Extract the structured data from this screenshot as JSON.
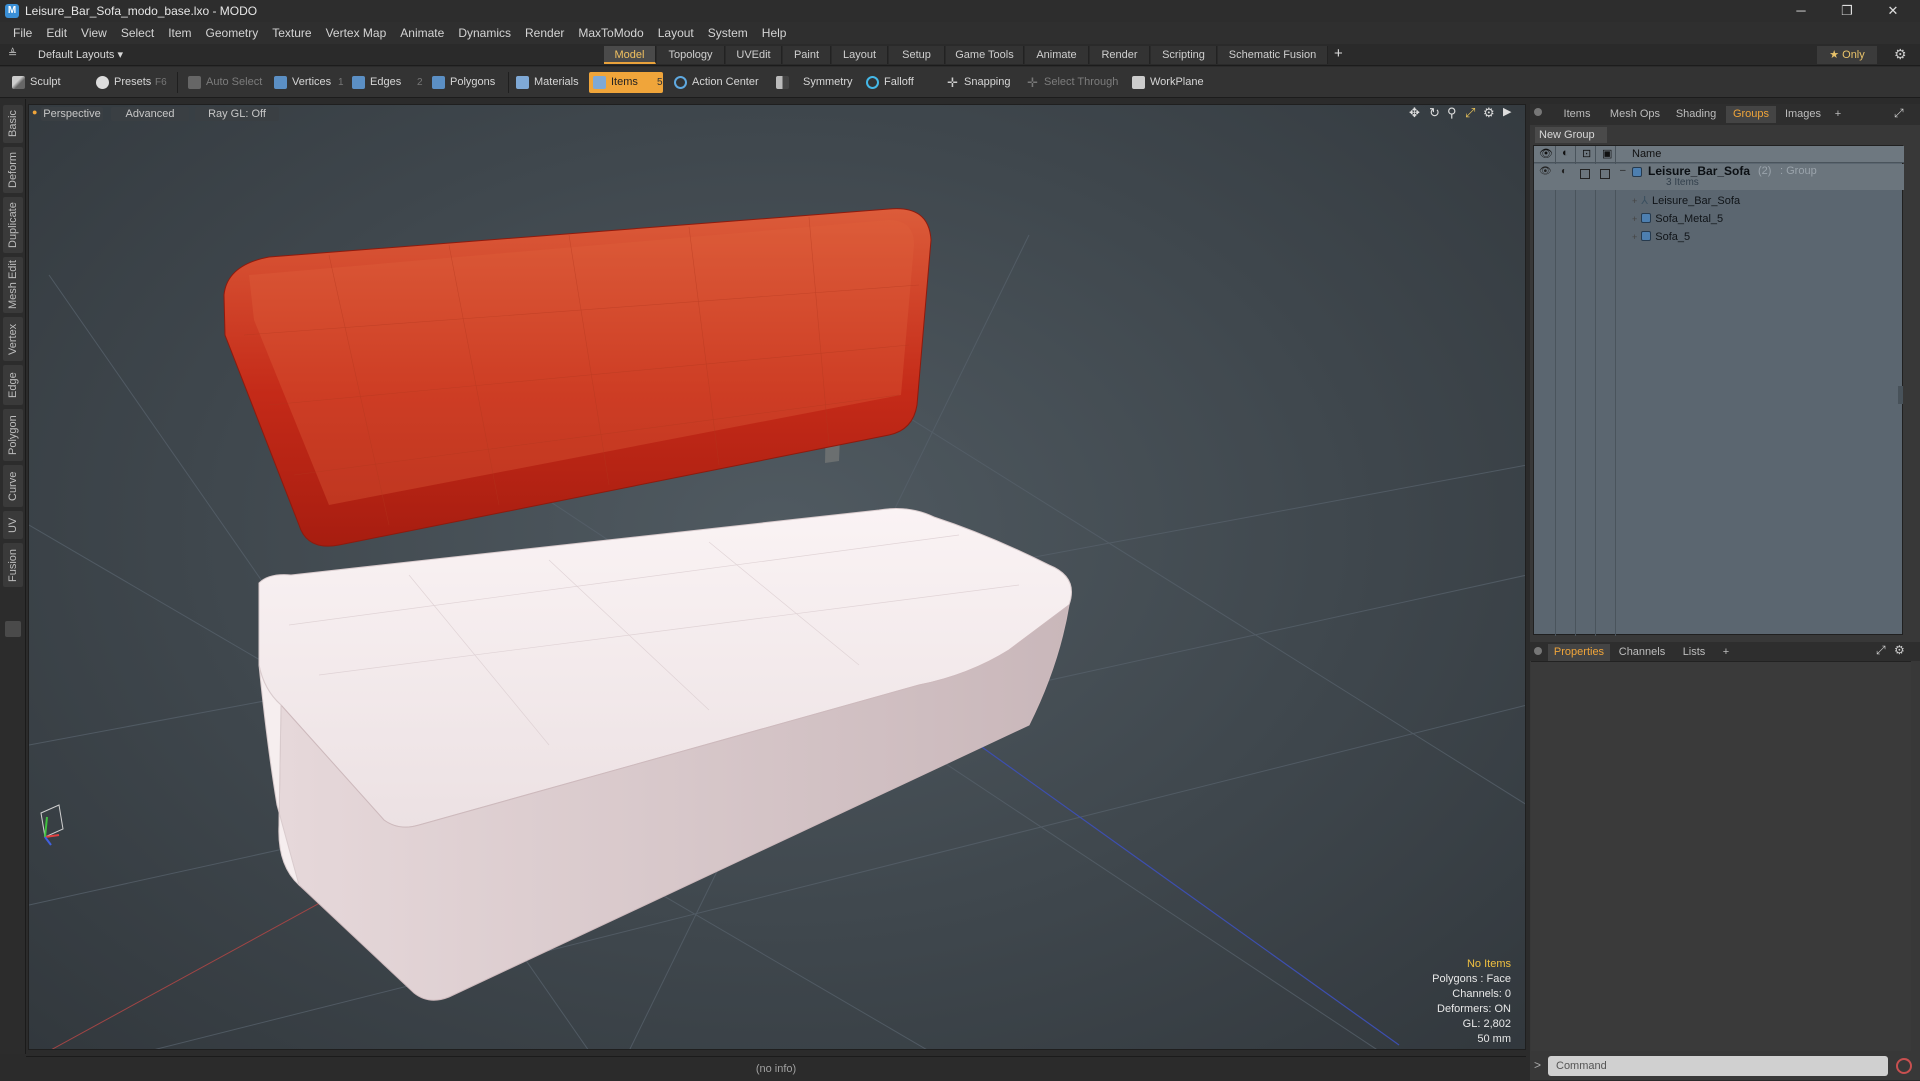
{
  "window": {
    "title": "Leisure_Bar_Sofa_modo_base.lxo - MODO",
    "app_icon": "modo-app-icon",
    "controls": [
      "minimize-icon",
      "restore-icon",
      "close-icon"
    ]
  },
  "menu": [
    "File",
    "Edit",
    "View",
    "Select",
    "Item",
    "Geometry",
    "Texture",
    "Vertex Map",
    "Animate",
    "Dynamics",
    "Render",
    "MaxToModo",
    "Layout",
    "System",
    "Help"
  ],
  "layout_bar": {
    "preset": "Default Layouts ▾",
    "tabs": [
      "Model",
      "Topology",
      "UVEdit",
      "Paint",
      "Layout",
      "Setup",
      "Game Tools",
      "Animate",
      "Render",
      "Scripting",
      "Schematic Fusion"
    ],
    "active_tab": "Model",
    "add_label": "+",
    "only_label": "★  Only"
  },
  "toolbar": {
    "sculpt": "Sculpt",
    "presets": "Presets",
    "presets_key": "F6",
    "auto_select": "Auto Select",
    "vertices": "Vertices",
    "vertices_key": "1",
    "edges": "Edges",
    "edges_key": "2",
    "polygons": "Polygons",
    "materials": "Materials",
    "items": "Items",
    "items_key": "5",
    "action_center": "Action Center",
    "symmetry": "Symmetry",
    "falloff": "Falloff",
    "snapping": "Snapping",
    "select_through": "Select Through",
    "workplane": "WorkPlane"
  },
  "left_tabs": [
    "Basic",
    "Deform",
    "Duplicate",
    "Mesh Edit",
    "Vertex",
    "Edge",
    "Polygon",
    "Curve",
    "UV",
    "Fusion"
  ],
  "viewport": {
    "view_mode": "Perspective",
    "shading": "Advanced",
    "raygl": "Ray GL: Off",
    "hud": {
      "selection": "No Items",
      "polygons": "Polygons : Face",
      "channels": "Channels: 0",
      "deformers": "Deformers: ON",
      "gl": "GL: 2,802",
      "lens": "50 mm"
    }
  },
  "status": "(no info)",
  "groups_panel": {
    "tabs": [
      "Items",
      "Mesh Ops",
      "Shading",
      "Groups",
      "Images",
      "+"
    ],
    "active_tab": "Groups",
    "new_group": "New Group",
    "name_header": "Name",
    "group_name": "Leisure_Bar_Sofa",
    "group_count": "(2)",
    "group_type": ": Group",
    "group_items": "3 Items",
    "children": [
      "Leisure_Bar_Sofa",
      "Sofa_Metal_5",
      "Sofa_5"
    ]
  },
  "properties_panel": {
    "tabs": [
      "Properties",
      "Channels",
      "Lists",
      "+"
    ],
    "active_tab": "Properties"
  },
  "command": {
    "prompt": ">",
    "placeholder": "Command"
  },
  "colors": {
    "accent": "#f0a53a",
    "cushion_white": "#f1e9ea",
    "backrest_red": "#c9361c",
    "viewport_bg": "#454d53"
  }
}
